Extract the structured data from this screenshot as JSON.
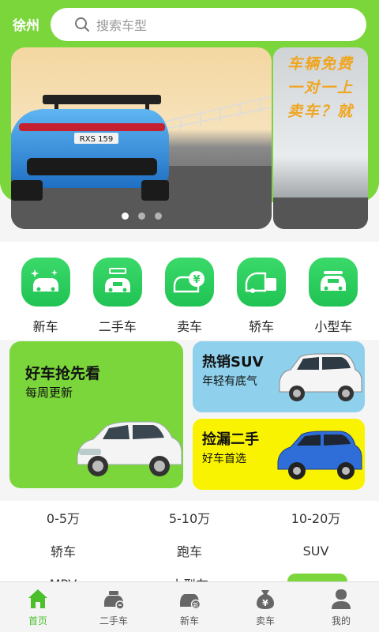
{
  "header": {
    "city": "徐州",
    "search_placeholder": "搜索车型"
  },
  "banner": {
    "plate": "RXS 159",
    "side_text_lines": [
      "车辆免费",
      "一对一上",
      "卖车？就"
    ],
    "dots": 3,
    "active_dot": 0
  },
  "categories": [
    {
      "label": "新车",
      "icon": "new-car-icon"
    },
    {
      "label": "二手车",
      "icon": "used-car-icon"
    },
    {
      "label": "卖车",
      "icon": "sell-car-icon"
    },
    {
      "label": "轿车",
      "icon": "sedan-icon"
    },
    {
      "label": "小型车",
      "icon": "small-car-icon"
    }
  ],
  "promos": {
    "hot_pick": {
      "title": "好车抢先看",
      "subtitle": "每周更新"
    },
    "suv": {
      "title": "热销SUV",
      "subtitle": "年轻有底气"
    },
    "bargain": {
      "title": "捡漏二手",
      "subtitle": "好车首选"
    }
  },
  "filters": {
    "row1": [
      "0-5万",
      "5-10万",
      "10-20万"
    ],
    "row2": [
      "轿车",
      "跑车",
      "SUV"
    ],
    "row3": [
      "MPV",
      "小型车",
      ""
    ]
  },
  "tabbar": [
    {
      "label": "首页",
      "icon": "home-icon",
      "active": true
    },
    {
      "label": "二手车",
      "icon": "used-car-tab-icon",
      "active": false
    },
    {
      "label": "新车",
      "icon": "new-car-tab-icon",
      "active": false
    },
    {
      "label": "卖车",
      "icon": "money-bag-icon",
      "active": false
    },
    {
      "label": "我的",
      "icon": "user-icon",
      "active": false
    }
  ],
  "colors": {
    "brand_green": "#7bd63c",
    "icon_green": "#2ccb5d",
    "suv_blue": "#8fd1ec",
    "bargain_yellow": "#f9f301"
  }
}
